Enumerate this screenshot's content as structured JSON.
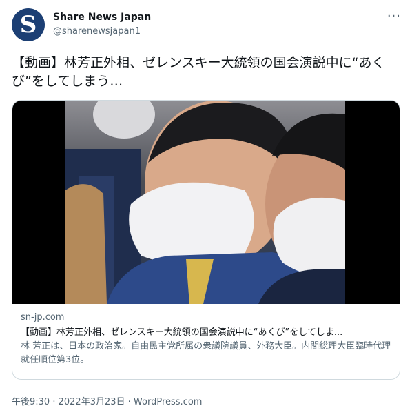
{
  "account": {
    "avatar_letter": "S",
    "display_name": "Share News Japan",
    "handle": "@sharenewsjapan1",
    "more_label": "···"
  },
  "tweet": {
    "text": "【動画】林芳正外相、ゼレンスキー大統領の国会演説中に“あくび”をしてしまう…"
  },
  "link_card": {
    "domain": "sn-jp.com",
    "title": "【動画】林芳正外相、ゼレンスキー大統領の国会演説中に“あくび”をしてしま...",
    "description": "林 芳正は、日本の政治家。自由民主党所属の衆議院議員、外務大臣。内閣総理大臣臨時代理就任順位第3位。"
  },
  "meta": {
    "time": "午後9:30",
    "sep1": " · ",
    "date": "2022年3月23日",
    "sep2": " · ",
    "source": "WordPress.com"
  },
  "colors": {
    "avatar_bg": "#1c3f74",
    "text": "#0f1419",
    "secondary": "#536471",
    "border": "#cfd9de"
  }
}
